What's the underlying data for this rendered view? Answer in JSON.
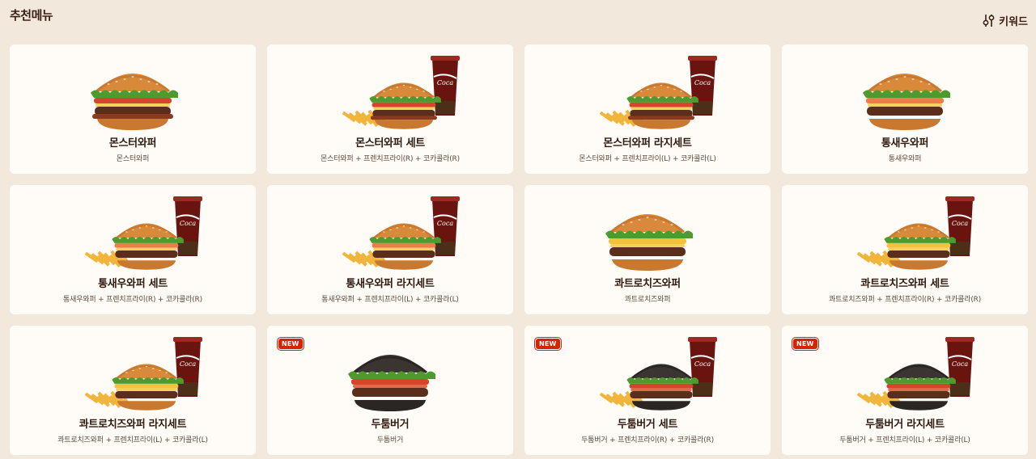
{
  "section_title": "추천메뉴",
  "keyword_button": {
    "label": "키워드",
    "icon": "sliders-icon"
  },
  "cards": [
    {
      "name": "몬스터와퍼",
      "desc": "몬스터와퍼",
      "badge": ""
    },
    {
      "name": "몬스터와퍼 세트",
      "desc": "몬스터와퍼 + 프렌치프라이(R) + 코카콜라(R)",
      "badge": ""
    },
    {
      "name": "몬스터와퍼 라지세트",
      "desc": "몬스터와퍼 + 프렌치프라이(L) + 코카콜라(L)",
      "badge": ""
    },
    {
      "name": "통새우와퍼",
      "desc": "통새우와퍼",
      "badge": ""
    },
    {
      "name": "통새우와퍼 세트",
      "desc": "통새우와퍼 + 프렌치프라이(R) + 코카콜라(R)",
      "badge": ""
    },
    {
      "name": "통새우와퍼 라지세트",
      "desc": "통새우와퍼 + 프렌치프라이(L) + 코카콜라(L)",
      "badge": ""
    },
    {
      "name": "콰트로치즈와퍼",
      "desc": "콰트로치즈와퍼",
      "badge": ""
    },
    {
      "name": "콰트로치즈와퍼 세트",
      "desc": "콰트로치즈와퍼 + 프렌치프라이(R) + 코카콜라(R)",
      "badge": ""
    },
    {
      "name": "콰트로치즈와퍼 라지세트",
      "desc": "콰트로치즈와퍼 + 프렌치프라이(L) + 코카콜라(L)",
      "badge": ""
    },
    {
      "name": "두툼버거",
      "desc": "두툼버거",
      "badge": "NEW"
    },
    {
      "name": "두툼버거 세트",
      "desc": "두툼버거 + 프렌치프라이(R) + 코카콜라(R)",
      "badge": "NEW"
    },
    {
      "name": "두툼버거 라지세트",
      "desc": "두툼버거 + 프렌치프라이(L) + 코카콜라(L)",
      "badge": "NEW"
    }
  ],
  "colors": {
    "background": "#f2e9dc",
    "card": "#fffcf7",
    "text": "#2f1a10",
    "badge": "#d62300"
  }
}
